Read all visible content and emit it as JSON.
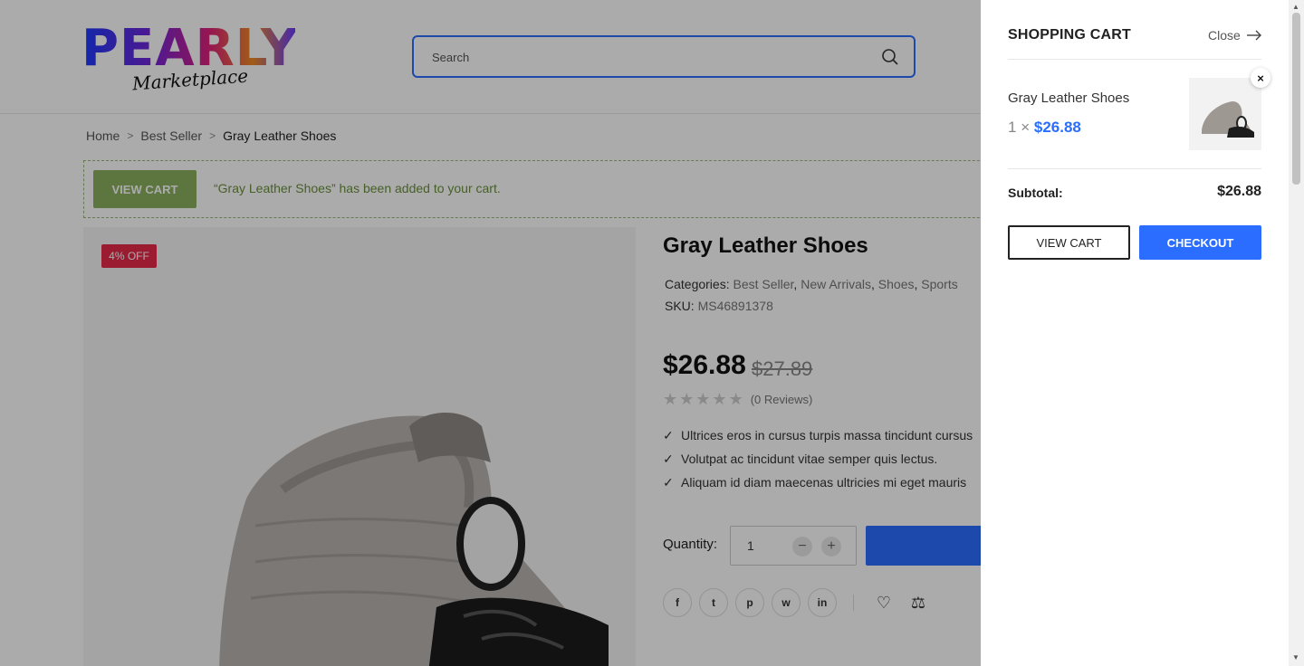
{
  "header": {
    "logo_main": "PEARLY",
    "logo_sub": "Marketplace",
    "search_placeholder": "Search"
  },
  "breadcrumb": {
    "items": [
      "Home",
      "Best Seller"
    ],
    "current": "Gray Leather Shoes"
  },
  "notice": {
    "button": "VIEW CART",
    "message": "“Gray Leather Shoes” has been added to your cart."
  },
  "product": {
    "badge": "4% OFF",
    "title": "Gray Leather Shoes",
    "categories_label": "Categories:",
    "categories": [
      "Best Seller",
      "New Arrivals",
      "Shoes",
      "Sports"
    ],
    "sku_label": "SKU:",
    "sku": "MS46891378",
    "price": "$26.88",
    "old_price": "$27.89",
    "rating": 0,
    "reviews": "(0 Reviews)",
    "features": [
      "Ultrices eros in cursus turpis massa tincidunt cursus",
      "Volutpat ac tincidunt vitae semper quis lectus.",
      "Aliquam id diam maecenas ultricies mi eget mauris"
    ],
    "quantity_label": "Quantity:",
    "quantity": "1"
  },
  "share_icons": [
    "facebook-icon",
    "twitter-icon",
    "pinterest-icon",
    "whatsapp-icon",
    "linkedin-icon"
  ],
  "share_glyphs": [
    "f",
    "t",
    "p",
    "w",
    "in"
  ],
  "cart": {
    "title": "SHOPPING CART",
    "close_label": "Close",
    "item_name": "Gray Leather Shoes",
    "item_qty": "1",
    "item_times": "×",
    "item_price": "$26.88",
    "subtotal_label": "Subtotal:",
    "subtotal_value": "$26.88",
    "view_cart": "VIEW CART",
    "checkout": "CHECKOUT"
  },
  "colors": {
    "accent": "#2a6dff",
    "badge": "#e8294a",
    "notice_green": "#8bb060"
  }
}
